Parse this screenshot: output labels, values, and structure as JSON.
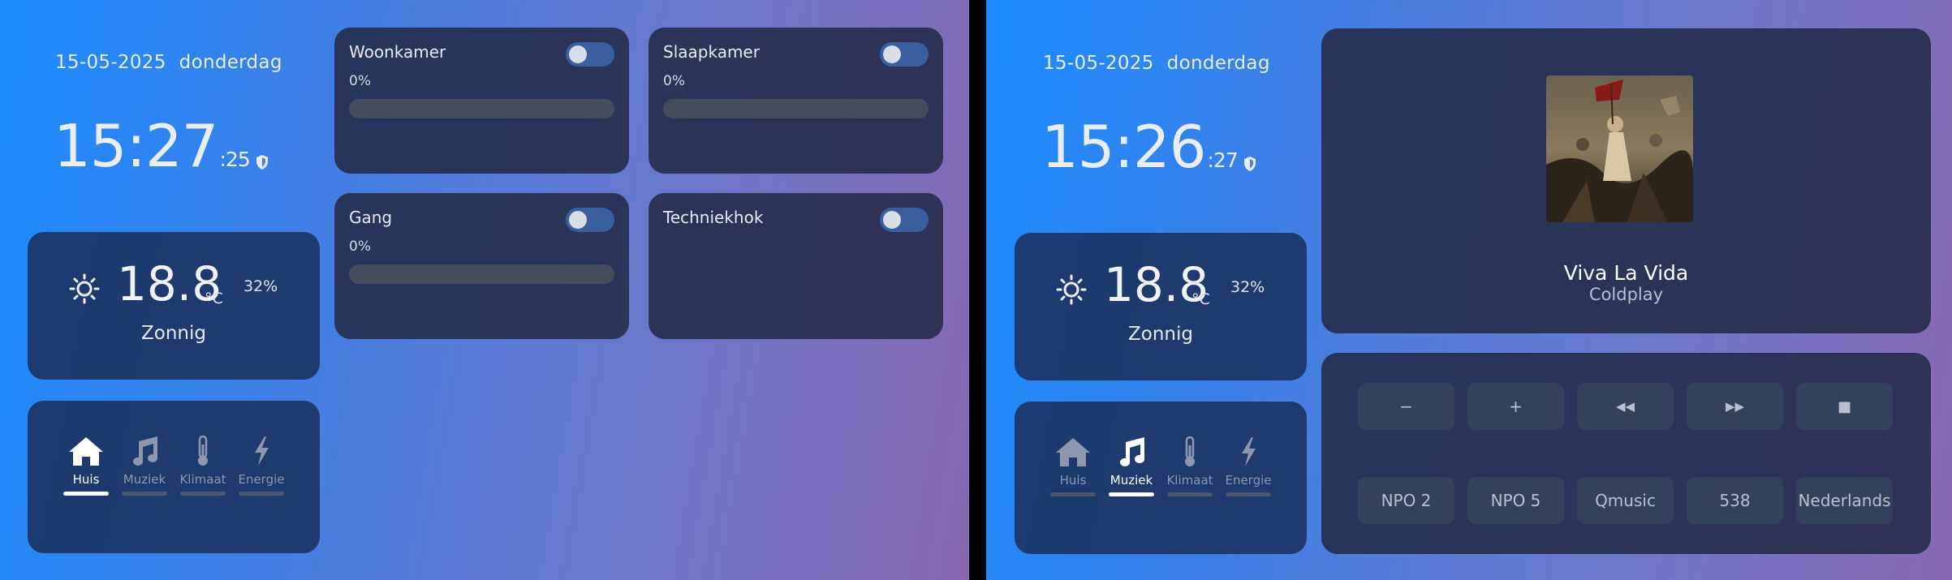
{
  "left": {
    "date": "15-05-2025",
    "weekday": "donderdag",
    "time_hm": "15:27",
    "time_sec": ":25",
    "weather": {
      "temp": "18.8",
      "unit": "°C",
      "humidity": "32%",
      "condition": "Zonnig",
      "icon": "sun-icon"
    },
    "nav": [
      {
        "label": "Huis",
        "icon": "house-icon",
        "active": true
      },
      {
        "label": "Muziek",
        "icon": "music-note-icon",
        "active": false
      },
      {
        "label": "Klimaat",
        "icon": "thermometer-icon",
        "active": false
      },
      {
        "label": "Energie",
        "icon": "lightning-icon",
        "active": false
      }
    ],
    "rooms": [
      {
        "name": "Woonkamer",
        "percent": "0%",
        "level": 0,
        "on": false
      },
      {
        "name": "Slaapkamer",
        "percent": "0%",
        "level": 0,
        "on": false
      },
      {
        "name": "Gang",
        "percent": "0%",
        "level": 0,
        "on": false
      },
      {
        "name": "Techniekhok",
        "on": false
      }
    ]
  },
  "right": {
    "date": "15-05-2025",
    "weekday": "donderdag",
    "time_hm": "15:26",
    "time_sec": ":27",
    "weather": {
      "temp": "18.8",
      "unit": "°C",
      "humidity": "32%",
      "condition": "Zonnig",
      "icon": "sun-icon"
    },
    "nav": [
      {
        "label": "Huis",
        "icon": "house-icon",
        "active": false
      },
      {
        "label": "Muziek",
        "icon": "music-note-icon",
        "active": true
      },
      {
        "label": "Klimaat",
        "icon": "thermometer-icon",
        "active": false
      },
      {
        "label": "Energie",
        "icon": "lightning-icon",
        "active": false
      }
    ],
    "now_playing": {
      "title": "Viva La Vida",
      "artist": "Coldplay",
      "album_art": "Viva La Vida"
    },
    "controls": [
      {
        "label": "−",
        "icon": "volume-down-icon"
      },
      {
        "label": "+",
        "icon": "volume-up-icon"
      },
      {
        "label": "◀◀",
        "icon": "rewind-icon"
      },
      {
        "label": "▶▶",
        "icon": "fast-forward-icon"
      },
      {
        "label": "■",
        "icon": "stop-icon"
      }
    ],
    "stations": [
      "NPO 2",
      "NPO 5",
      "Qmusic",
      "538",
      "Nederlands"
    ]
  },
  "colors": {
    "card": "#232a48",
    "toggle": "#3a5f9e",
    "accent": "#1a8cff"
  }
}
